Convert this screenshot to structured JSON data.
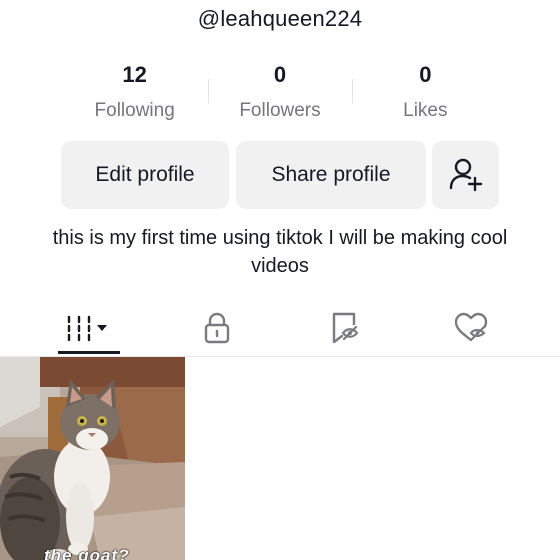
{
  "profile": {
    "username": "@leahqueen224",
    "bio": "this is my first time using tiktok I will be making cool videos"
  },
  "stats": [
    {
      "value": "12",
      "label": "Following"
    },
    {
      "value": "0",
      "label": "Followers"
    },
    {
      "value": "0",
      "label": "Likes"
    }
  ],
  "buttons": {
    "edit_profile": "Edit profile",
    "share_profile": "Share profile",
    "add_friend_icon": "add-user-icon"
  },
  "tabs": [
    {
      "icon": "videos-grid-icon",
      "active": true
    },
    {
      "icon": "lock-icon",
      "active": false
    },
    {
      "icon": "favorites-icon",
      "active": false
    },
    {
      "icon": "liked-hidden-icon",
      "active": false
    }
  ],
  "videos": [
    {
      "caption": "the goat?"
    }
  ],
  "colors": {
    "text": "#161823",
    "secondary_text": "#75767c",
    "button_bg": "#f1f1f2",
    "background": "#ffffff"
  }
}
